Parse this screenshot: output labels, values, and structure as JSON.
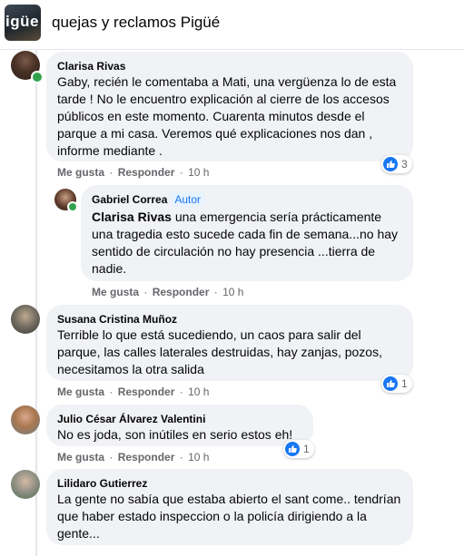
{
  "header": {
    "group_thumb_text": "igüe",
    "group_name": "quejas y reclamos Pigüé"
  },
  "actions_labels": {
    "like": "Me gusta",
    "reply": "Responder",
    "separator": "·"
  },
  "comments": [
    {
      "author": "Clarisa Rivas",
      "text": "Gaby, recién le comentaba a Mati, una vergüenza lo de esta tarde ! No le encuentro explicación al cierre de los accesos públicos en este momento. Cuarenta minutos desde el parque a mi casa. Veremos qué explicaciones nos dan , informe mediante .",
      "time": "10 h",
      "reactions": "3"
    },
    {
      "author": "Gabriel Correa",
      "badge": "Autor",
      "mention": "Clarisa Rivas",
      "text": "una emergencia sería prácticamente una tragedia esto sucede cada fin de semana...no hay sentido de circulación no hay presencia ...tierra de nadie.",
      "time": "10 h"
    },
    {
      "author": "Susana Cristina Muñoz",
      "text": "Terrible lo que está sucediendo, un caos para salir del parque, las calles laterales destruidas, hay zanjas, pozos, necesitamos la otra salida",
      "time": "10 h",
      "reactions": "1"
    },
    {
      "author": "Julio César Álvarez Valentini",
      "text": "No es joda, son inútiles en serio estos eh!",
      "time": "10 h",
      "reactions": "1"
    },
    {
      "author": "Lilidaro Gutierrez",
      "text": "La gente no sabía que estaba abierto el sant come.. tendrían que haber estado inspeccion o la policía dirigiendo a la gente..."
    }
  ],
  "colors": {
    "bubble": "#f0f2f5",
    "like_blue": "#1877f2",
    "meta_gray": "#65676b",
    "online_green": "#31a24c"
  }
}
